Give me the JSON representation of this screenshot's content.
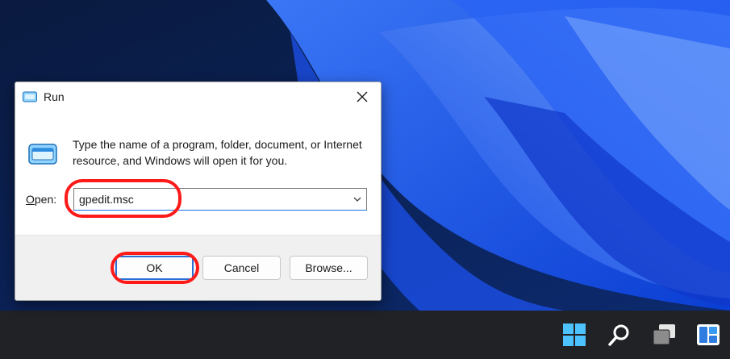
{
  "dialog": {
    "title": "Run",
    "description": "Type the name of a program, folder, document, or Internet resource, and Windows will open it for you.",
    "open_label_underlined": "O",
    "open_label_rest": "pen:",
    "open_value": "gpedit.msc",
    "buttons": {
      "ok": "OK",
      "cancel": "Cancel",
      "browse": "Browse..."
    }
  },
  "taskbar": {
    "icons": [
      "windows-start-icon",
      "search-icon",
      "task-view-icon",
      "widgets-icon"
    ]
  },
  "colors": {
    "annotation": "#ff1a1a",
    "accent": "#2a6fd6",
    "taskbar": "#202226"
  }
}
